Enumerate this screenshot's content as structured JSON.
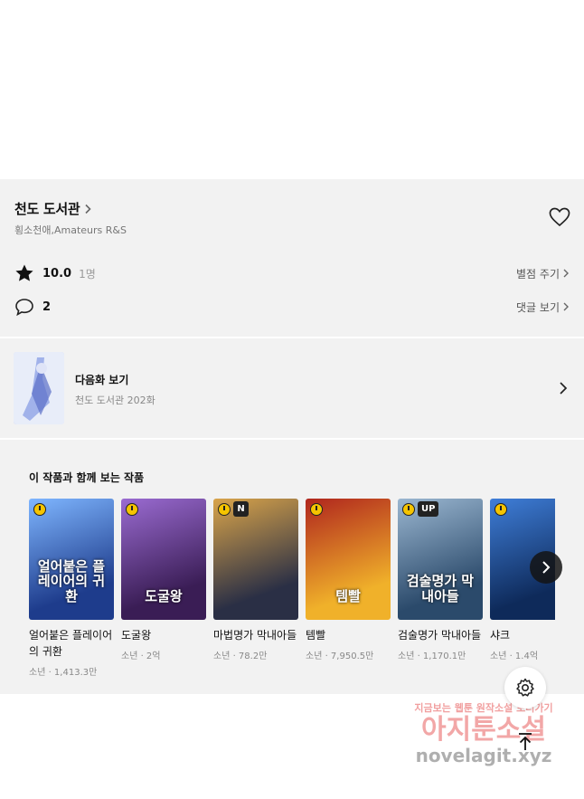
{
  "work": {
    "title": "천도 도서관",
    "authors": "횡소천애,Amateurs R&S",
    "rating": "10.0",
    "rating_count": "1명",
    "rate_link": "별점 주기",
    "comment_count": "2",
    "comment_link": "댓글 보기"
  },
  "next_episode": {
    "label": "다음화 보기",
    "subtitle": "천도 도서관 202화"
  },
  "recommendations": {
    "heading": "이 작품과 함께 보는 작품",
    "items": [
      {
        "title": "얼어붙은 플레이어의 귀환",
        "meta": "소년 · 1,413.3만",
        "badge": "",
        "cover_text": "얼어붙은 플레이어의 귀환",
        "color_a": "#1e3c8c",
        "color_b": "#7fb6ff"
      },
      {
        "title": "도굴왕",
        "meta": "소년 · 2억",
        "badge": "",
        "cover_text": "도굴왕",
        "color_a": "#3a1d55",
        "color_b": "#9a6bd1"
      },
      {
        "title": "마법명가 막내아들",
        "meta": "소년 · 78.2만",
        "badge": "N",
        "cover_text": "",
        "color_a": "#2a2f45",
        "color_b": "#d9a44a"
      },
      {
        "title": "템빨",
        "meta": "소년 · 7,950.5만",
        "badge": "",
        "cover_text": "템빨",
        "color_a": "#f0b12a",
        "color_b": "#b0261e"
      },
      {
        "title": "검술명가 막내아들",
        "meta": "소년 · 1,170.1만",
        "badge": "UP",
        "cover_text": "검술명가 막내아들",
        "color_a": "#2b4a6b",
        "color_b": "#9bb7d1"
      },
      {
        "title": "샤크",
        "meta": "소년 · 1.4억",
        "badge": "",
        "cover_text": "",
        "color_a": "#0e2a5a",
        "color_b": "#3f7ed8"
      }
    ]
  },
  "watermark": {
    "line1": "지금보는 웹툰 원작소설 보러가기",
    "line2": "아지툰소설",
    "line3": "novelagit.xyz"
  },
  "colors": {
    "panel_bg": "#f2f2f2",
    "badge_yellow": "#f5c400"
  },
  "icons": [
    "chevron-right-icon",
    "heart-icon",
    "star-icon",
    "comment-icon",
    "settings-icon",
    "arrow-up-icon",
    "clock-icon"
  ]
}
